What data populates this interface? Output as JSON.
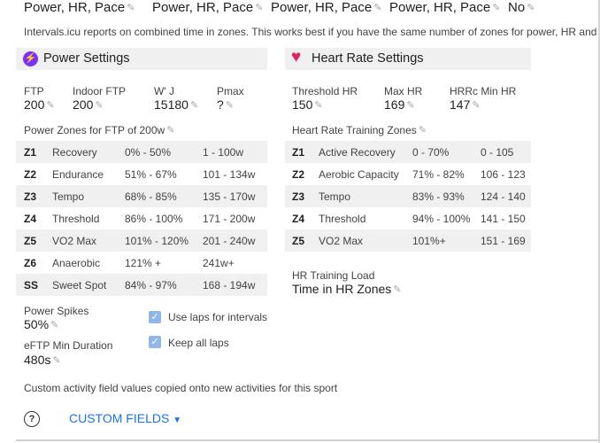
{
  "top_row": [
    {
      "value": "Power, HR, Pace"
    },
    {
      "value": "Power, HR, Pace"
    },
    {
      "value": "Power, HR, Pace"
    },
    {
      "value": "Power, HR, Pace"
    },
    {
      "value": "No"
    }
  ],
  "zones_note": "Intervals.icu reports on combined time in zones. This works best if you have the same number of zones for power, HR and p",
  "power": {
    "title": "Power Settings",
    "icon": "lightning-bolt-icon",
    "fields": {
      "ftp": {
        "label": "FTP",
        "value": "200"
      },
      "indoor_ftp": {
        "label": "Indoor FTP",
        "value": "200"
      },
      "w_prime": {
        "label": "W' J",
        "value": "15180"
      },
      "pmax": {
        "label": "Pmax",
        "value": "?"
      }
    },
    "zones_title": "Power Zones for FTP of 200w",
    "zones": [
      {
        "id": "Z1",
        "name": "Recovery",
        "pct": "0% - 50%",
        "watts": "1 - 100w"
      },
      {
        "id": "Z2",
        "name": "Endurance",
        "pct": "51% - 67%",
        "watts": "101 - 134w"
      },
      {
        "id": "Z3",
        "name": "Tempo",
        "pct": "68% - 85%",
        "watts": "135 - 170w"
      },
      {
        "id": "Z4",
        "name": "Threshold",
        "pct": "86% - 100%",
        "watts": "171 - 200w"
      },
      {
        "id": "Z5",
        "name": "VO2 Max",
        "pct": "101% - 120%",
        "watts": "201 - 240w"
      },
      {
        "id": "Z6",
        "name": "Anaerobic",
        "pct": "121% +",
        "watts": "241w+"
      },
      {
        "id": "SS",
        "name": "Sweet Spot",
        "pct": "84% - 97%",
        "watts": "168 - 194w"
      }
    ],
    "power_spikes": {
      "label": "Power Spikes",
      "value": "50%"
    },
    "eftp_min_duration": {
      "label": "eFTP Min Duration",
      "value": "480s"
    },
    "checkboxes": {
      "use_laps": {
        "label": "Use laps for intervals",
        "checked": true
      },
      "keep_all_laps": {
        "label": "Keep all laps",
        "checked": true
      }
    }
  },
  "hr": {
    "title": "Heart Rate Settings",
    "icon": "heart-icon",
    "fields": {
      "threshold_hr": {
        "label": "Threshold HR",
        "value": "150"
      },
      "max_hr": {
        "label": "Max HR",
        "value": "169"
      },
      "hrrc_min_hr": {
        "label": "HRRc Min HR",
        "value": "147"
      }
    },
    "zones_title": "Heart Rate Training Zones",
    "zones": [
      {
        "id": "Z1",
        "name": "Active Recovery",
        "pct": "0 - 70%",
        "bpm": "0 - 105"
      },
      {
        "id": "Z2",
        "name": "Aerobic Capacity",
        "pct": "71% - 82%",
        "bpm": "106 - 123"
      },
      {
        "id": "Z3",
        "name": "Tempo",
        "pct": "83% - 93%",
        "bpm": "124 - 140"
      },
      {
        "id": "Z4",
        "name": "Threshold",
        "pct": "94% - 100%",
        "bpm": "141 - 150"
      },
      {
        "id": "Z5",
        "name": "VO2 Max",
        "pct": "101%+",
        "bpm": "151 - 169"
      }
    ],
    "training_load": {
      "label": "HR Training Load",
      "value": "Time in HR Zones"
    }
  },
  "custom_fields_note": "Custom activity field values copied onto new activities for this sport",
  "help_icon": "question-circle-icon",
  "custom_fields_button": "CUSTOM FIELDS",
  "colors": {
    "accent_blue": "#1a73e8",
    "power_icon_purple": "#7b2ff7",
    "heart_red": "#e0245e",
    "row_shade": "#f0f0f0"
  }
}
